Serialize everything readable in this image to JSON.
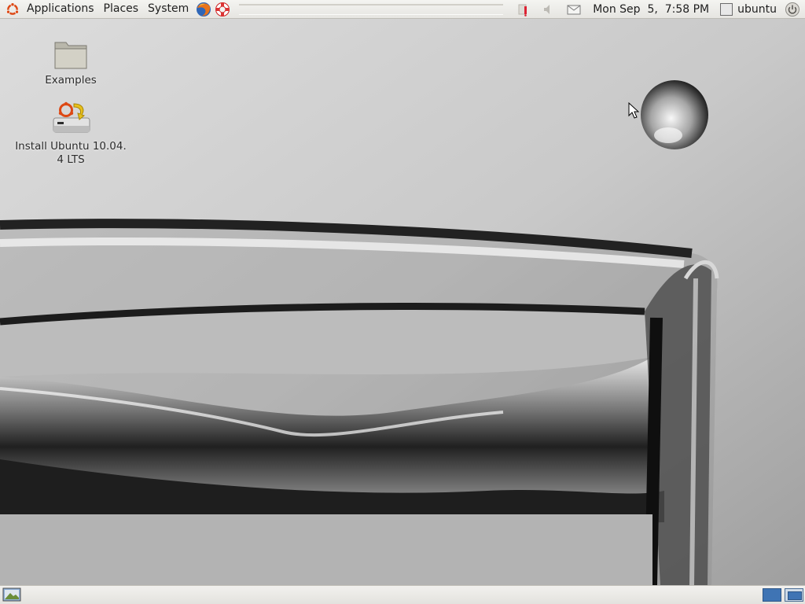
{
  "top_panel": {
    "menus": [
      "Applications",
      "Places",
      "System"
    ],
    "clock": "Mon Sep  5,  7:58 PM",
    "user": "ubuntu",
    "launchers": [
      "firefox-icon",
      "help-lifebuoy-icon"
    ],
    "tray_icons": [
      "update-notifier-icon",
      "volume-icon",
      "mail-icon",
      "power-icon"
    ]
  },
  "desktop": {
    "icons": [
      {
        "label": "Examples",
        "icon": "folder-icon"
      },
      {
        "label": "Install Ubuntu 10.04.\n4 LTS",
        "icon": "install-ubuntu-icon"
      }
    ]
  },
  "bottom_panel": {
    "show_desktop_icon": "show-desktop-icon",
    "workspaces": 2,
    "active_workspace": 1
  },
  "colors": {
    "panel": "#e6e5e1",
    "workspace_active": "#3f74b4",
    "ubuntu_orange": "#dd4814"
  }
}
